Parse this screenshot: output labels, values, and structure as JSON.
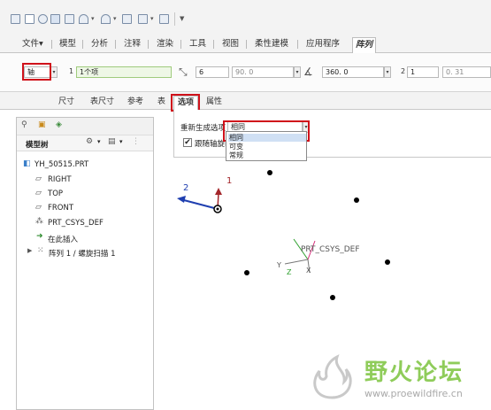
{
  "ribbon": {
    "tabs": [
      "文件▾",
      "模型",
      "分析",
      "注释",
      "渲染",
      "工具",
      "视图",
      "柔性建模",
      "应用程序",
      "阵列"
    ],
    "active_tab": "阵列",
    "type_select": "轴",
    "member1_label": "1",
    "member1_value": "1个项",
    "member1_count": "6",
    "member1_angle": "90. 0",
    "angle_total": "360. 0",
    "member2_label": "2",
    "member2_count": "1",
    "member2_angle": "0. 31"
  },
  "subtabs": [
    "尺寸",
    "表尺寸",
    "参考",
    "表",
    "选项",
    "属性"
  ],
  "active_subtab": "选项",
  "options": {
    "regen_label": "重新生成选项",
    "regen_value": "相同",
    "follow_axis_label": "跟随轴旋转",
    "follow_axis_checked": "✔",
    "dropdown_options": [
      "相同",
      "可变",
      "常规"
    ],
    "dropdown_highlight": "相同"
  },
  "tree": {
    "header": "模型树",
    "items": [
      {
        "icon": "part-icon",
        "label": "YH_50515.PRT"
      },
      {
        "icon": "datum-plane-icon",
        "label": "RIGHT"
      },
      {
        "icon": "datum-plane-icon",
        "label": "TOP"
      },
      {
        "icon": "datum-plane-icon",
        "label": "FRONT"
      },
      {
        "icon": "csys-icon",
        "label": "PRT_CSYS_DEF"
      },
      {
        "icon": "insert-here-icon",
        "label": "在此插入"
      },
      {
        "icon": "pattern-icon",
        "label": "阵列 1 / 螺旋扫描 1"
      }
    ]
  },
  "graphics": {
    "dir1_label": "1",
    "dir2_label": "2",
    "csys_label": "PRT_CSYS_DEF",
    "axis_x": "X",
    "axis_y": "Y",
    "axis_z": "Z"
  },
  "watermark": {
    "title": "野火论坛",
    "url": "www.proewildfire.cn"
  },
  "colors": {
    "highlight_box": "#d0121b",
    "dir1_arrow": "#a3262a",
    "dir2_arrow": "#1f3fb0",
    "watermark_green": "#7fc24a"
  }
}
